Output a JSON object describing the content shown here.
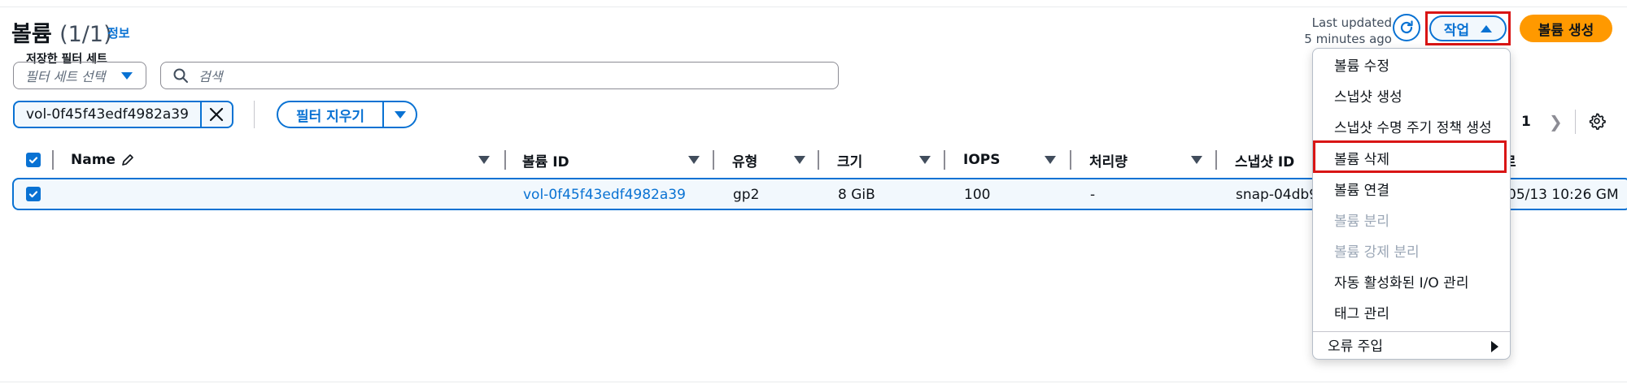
{
  "header": {
    "title": "볼륨",
    "count": "(1/1)",
    "info_link": "정보",
    "last_updated_line1": "Last updated",
    "last_updated_line2": "5 minutes ago",
    "actions_label": "작업",
    "create_label": "볼륨 생성"
  },
  "filters": {
    "saved_label": "저장한 필터 세트",
    "saved_placeholder": "필터 세트 선택",
    "search_placeholder": "검색",
    "token_value": "vol-0f45f43edf4982a39",
    "clear_label": "필터 지우기"
  },
  "pagination": {
    "current_page": "1"
  },
  "table": {
    "columns": [
      "Name",
      "볼륨 ID",
      "유형",
      "크기",
      "IOPS",
      "처리량",
      "스냅샷 ID",
      "로"
    ],
    "rows": [
      {
        "name": "",
        "volume_id": "vol-0f45f43edf4982a39",
        "type": "gp2",
        "size": "8 GiB",
        "iops": "100",
        "throughput": "-",
        "snapshot_id": "snap-04db9",
        "created": "05/13 10:26 GM"
      }
    ]
  },
  "menu": {
    "items": [
      {
        "label": "볼륨 수정",
        "disabled": false
      },
      {
        "label": "스냅샷 생성",
        "disabled": false
      },
      {
        "label": "스냅샷 수명 주기 정책 생성",
        "disabled": false
      },
      {
        "label": "볼륨 삭제",
        "disabled": false,
        "highlighted": true
      },
      {
        "label": "볼륨 연결",
        "disabled": false
      },
      {
        "label": "볼륨 분리",
        "disabled": true
      },
      {
        "label": "볼륨 강제 분리",
        "disabled": true
      },
      {
        "label": "자동 활성화된 I/O 관리",
        "disabled": false
      },
      {
        "label": "태그 관리",
        "disabled": false
      }
    ],
    "fault_injection": "오류 주입"
  },
  "colors": {
    "accent": "#0972d3",
    "primary_button": "#ff9900",
    "highlight_red": "#d91515"
  }
}
